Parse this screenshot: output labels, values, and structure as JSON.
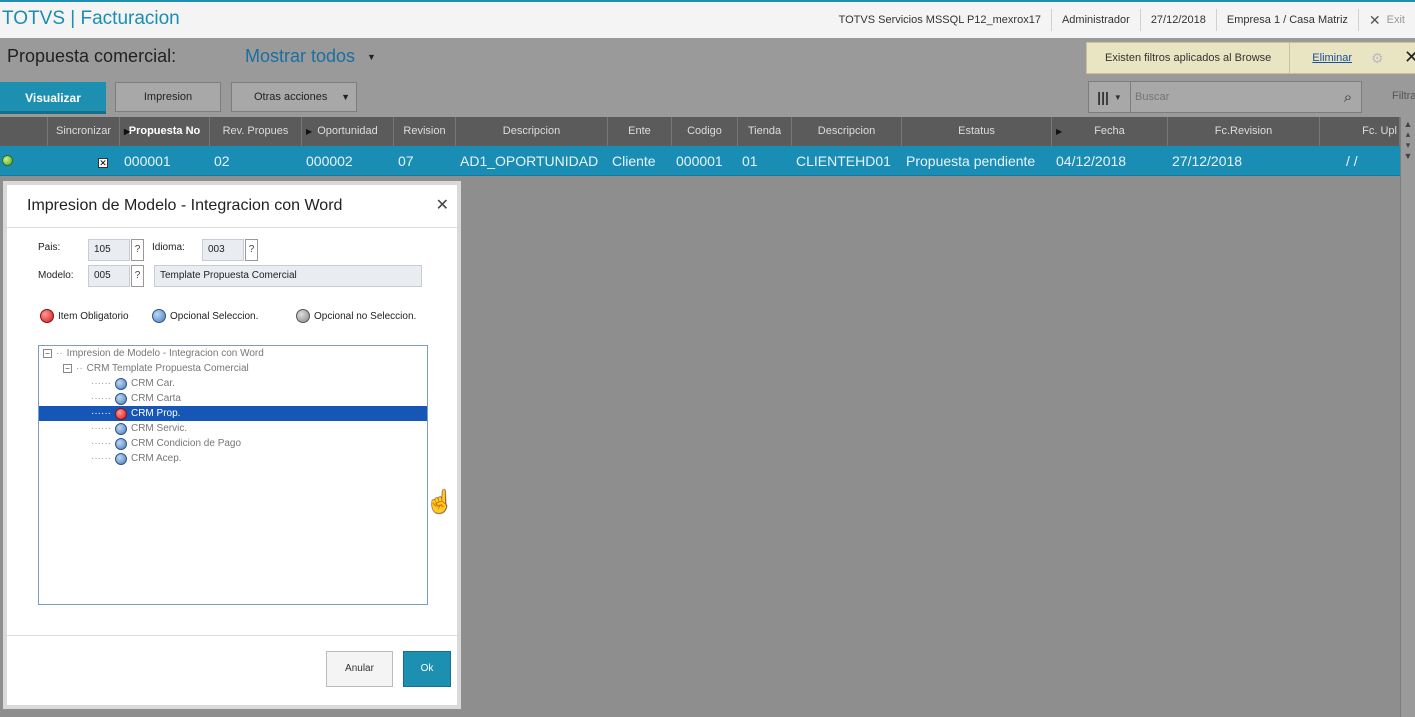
{
  "app": {
    "title": "TOTVS | Facturacion"
  },
  "topinfo": {
    "environment": "TOTVS Servicios MSSQL P12_mexrox17",
    "user": "Administrador",
    "date": "27/12/2018",
    "company": "Empresa 1 / Casa Matriz",
    "exit_label": "Exit"
  },
  "header": {
    "page_title": "Propuesta comercial:",
    "view_selector": "Mostrar todos",
    "filter_notice": "Existen filtros aplicados al Browse",
    "filter_remove": "Eliminar",
    "filtra_label": "Filtra"
  },
  "toolbar": {
    "visualizar": "Visualizar",
    "impresion": "Impresion",
    "otras_acciones": "Otras acciones",
    "search_placeholder": "Buscar"
  },
  "grid": {
    "columns": [
      "",
      "Sincronizar",
      "Propuesta No",
      "Rev. Propues",
      "Oportunidad",
      "Revision",
      "Descripcion",
      "Ente",
      "Codigo",
      "Tienda",
      "Descripcion",
      "Estatus",
      "Fecha",
      "Fc.Revision",
      "Fc. Upl"
    ],
    "rows": [
      {
        "propuesta": "000001",
        "rev": "02",
        "oportunidad": "000002",
        "revision": "07",
        "descripcion": "AD1_OPORTUNIDAD",
        "ente": "Cliente",
        "codigo": "000001",
        "tienda": "01",
        "descripcion2": "CLIENTEHD01",
        "estatus": "Propuesta pendiente",
        "fecha": "04/12/2018",
        "fc_revision": "27/12/2018",
        "fc_upl": "/ /"
      }
    ]
  },
  "dialog": {
    "title": "Impresion de Modelo - Integracion con Word",
    "pais_label": "Pais:",
    "pais_value": "105",
    "idioma_label": "Idioma:",
    "idioma_value": "003",
    "modelo_label": "Modelo:",
    "modelo_value": "005",
    "modelo_desc": "Template Propuesta Comercial",
    "help": "?",
    "legend": {
      "obligatorio": "Item Obligatorio",
      "opcional_sel": "Opcional Seleccion.",
      "opcional_nosel": "Opcional no Seleccion."
    },
    "tree": {
      "root": "Impresion de Modelo - Integracion con Word",
      "group": "CRM Template Propuesta Comercial",
      "items": [
        "CRM Car.",
        "CRM Carta",
        "CRM Prop.",
        "CRM Servic.",
        "CRM Condicion de Pago",
        "CRM Acep."
      ]
    },
    "cancel": "Anular",
    "ok": "Ok"
  },
  "colors": {
    "accent": "#1a8db5",
    "selection": "#1656b6",
    "notice_bg": "#e9e4c2"
  }
}
